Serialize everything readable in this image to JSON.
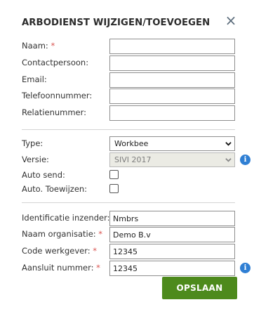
{
  "dialog": {
    "title": "ARBODIENST WIJZIGEN/TOEVOEGEN",
    "close_symbol": "×"
  },
  "contact": {
    "naam": {
      "label": "Naam:",
      "required": "*",
      "value": ""
    },
    "contactpersoon": {
      "label": "Contactpersoon:",
      "value": ""
    },
    "email": {
      "label": "Email:",
      "value": ""
    },
    "telefoonnummer": {
      "label": "Telefoonnummer:",
      "value": ""
    },
    "relatienummer": {
      "label": "Relatienummer:",
      "value": ""
    }
  },
  "settings": {
    "type": {
      "label": "Type:",
      "value": "Workbee"
    },
    "versie": {
      "label": "Versie:",
      "value": "SIVI 2017",
      "disabled": true
    },
    "auto_send": {
      "label": "Auto send:",
      "checked": false
    },
    "auto_toewijzen": {
      "label": "Auto. Toewijzen:",
      "checked": false
    }
  },
  "identification": {
    "inzender": {
      "label": "Identificatie inzender:",
      "required": "*",
      "value": "Nmbrs"
    },
    "organisatie": {
      "label": "Naam organisatie:",
      "required": "*",
      "value": "Demo B.v"
    },
    "werkgever": {
      "label": "Code werkgever:",
      "required": "*",
      "value": "12345"
    },
    "aansluit": {
      "label": "Aansluit nummer:",
      "required": "*",
      "value": "12345"
    }
  },
  "actions": {
    "save_label": "OPSLAAN"
  },
  "icons": {
    "info": "i",
    "info_icon": "info-icon",
    "close_icon": "close-icon",
    "chevron_icon": "chevron-down-icon"
  },
  "colors": {
    "accent_green": "#4d8a1c",
    "info_blue": "#2f7fd4",
    "required_red": "#d9534f"
  }
}
